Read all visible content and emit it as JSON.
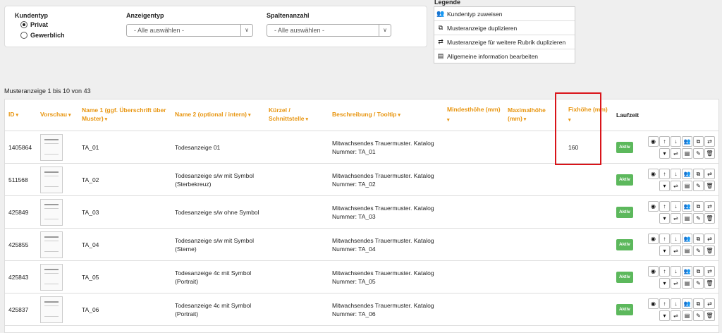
{
  "filters": {
    "kundentyp_label": "Kundentyp",
    "kundentyp_options": [
      "Privat",
      "Gewerblich"
    ],
    "anzeigentyp_label": "Anzeigentyp",
    "anzeigentyp_value": "- Alle auswählen -",
    "spaltenanzahl_label": "Spaltenanzahl",
    "spaltenanzahl_value": "- Alle auswählen -"
  },
  "legend": {
    "title": "Legende",
    "items": [
      {
        "icon": "users-icon",
        "label": "Kundentyp zuweisen"
      },
      {
        "icon": "copy-icon",
        "label": "Musteranzeige duplizieren"
      },
      {
        "icon": "retweet-icon",
        "label": "Musteranzeige für weitere Rubrik duplizieren"
      },
      {
        "icon": "file-icon",
        "label": "Allgemeine information bearbeiten"
      }
    ]
  },
  "count_text": "Musteranzeige 1 bis 10 von 43",
  "table": {
    "headers": {
      "id": "ID",
      "vorschau": "Vorschau",
      "name1": "Name 1 (ggf. Überschrift über Muster)",
      "name2": "Name 2 (optional / intern)",
      "kuerzel": "Kürzel / Schnittstelle",
      "beschreibung": "Beschreibung / Tooltip",
      "mindesthoehe": "Mindesthöhe (mm)",
      "maximalhoehe": "Maximalhöhe (mm)",
      "fixhoehe": "Fixhöhe (mm)",
      "laufzeit": "Laufzeit"
    },
    "rows": [
      {
        "id": "1405864",
        "name1": "TA_01",
        "name2": "Todesanzeige 01",
        "kuerzel": "",
        "beschreibung": "Mitwachsendes Trauermuster. Katalog Nummer: TA_01",
        "min": "",
        "max": "",
        "fix": "160",
        "status": "Aktiv"
      },
      {
        "id": "511568",
        "name1": "TA_02",
        "name2": "Todesanzeige s/w mit Symbol (Sterbekreuz)",
        "kuerzel": "",
        "beschreibung": "Mitwachsendes Trauermuster. Katalog Nummer: TA_02",
        "min": "",
        "max": "",
        "fix": "",
        "status": "Aktiv"
      },
      {
        "id": "425849",
        "name1": "TA_03",
        "name2": "Todesanzeige s/w ohne Symbol",
        "kuerzel": "",
        "beschreibung": "Mitwachsendes Trauermuster. Katalog Nummer: TA_03",
        "min": "",
        "max": "",
        "fix": "",
        "status": "Aktiv"
      },
      {
        "id": "425855",
        "name1": "TA_04",
        "name2": "Todesanzeige s/w mit Symbol (Sterne)",
        "kuerzel": "",
        "beschreibung": "Mitwachsendes Trauermuster. Katalog Nummer: TA_04",
        "min": "",
        "max": "",
        "fix": "",
        "status": "Aktiv"
      },
      {
        "id": "425843",
        "name1": "TA_05",
        "name2": "Todesanzeige 4c mit Symbol (Portrait)",
        "kuerzel": "",
        "beschreibung": "Mitwachsendes Trauermuster. Katalog Nummer: TA_05",
        "min": "",
        "max": "",
        "fix": "",
        "status": "Aktiv"
      },
      {
        "id": "425837",
        "name1": "TA_06",
        "name2": "Todesanzeige 4c mit Symbol (Portrait)",
        "kuerzel": "",
        "beschreibung": "Mitwachsendes Trauermuster. Katalog Nummer: TA_06",
        "min": "",
        "max": "",
        "fix": "",
        "status": "Aktiv"
      }
    ]
  },
  "colors": {
    "accent": "#e8950f",
    "active": "#5cb85c",
    "highlight": "#d9141a"
  }
}
